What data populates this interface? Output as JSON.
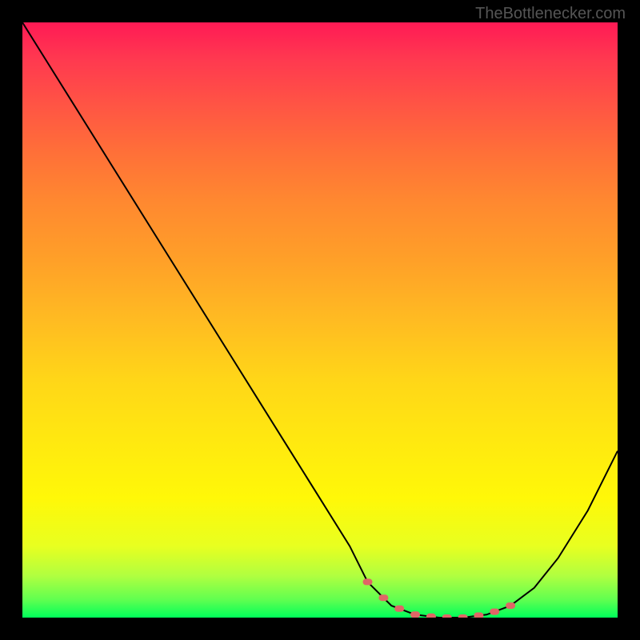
{
  "watermark": "TheBottlenecker.com",
  "chart_data": {
    "type": "line",
    "title": "",
    "xlabel": "",
    "ylabel": "",
    "xlim": [
      0,
      100
    ],
    "ylim": [
      0,
      100
    ],
    "series": [
      {
        "name": "curve",
        "x": [
          0,
          5,
          10,
          15,
          20,
          25,
          30,
          35,
          40,
          45,
          50,
          55,
          58,
          62,
          66,
          70,
          74,
          78,
          82,
          86,
          90,
          95,
          100
        ],
        "y": [
          100,
          92,
          84,
          76,
          68,
          60,
          52,
          44,
          36,
          28,
          20,
          12,
          6,
          2,
          0.5,
          0,
          0,
          0.5,
          2,
          5,
          10,
          18,
          28
        ]
      }
    ],
    "flat_region": {
      "x_start": 58,
      "x_end": 82,
      "marker_color": "#e06666",
      "marker_count": 10
    },
    "colors": {
      "gradient_top": "#ff1a55",
      "gradient_bottom": "#00ff5a",
      "curve": "#000000",
      "background": "#000000"
    }
  }
}
